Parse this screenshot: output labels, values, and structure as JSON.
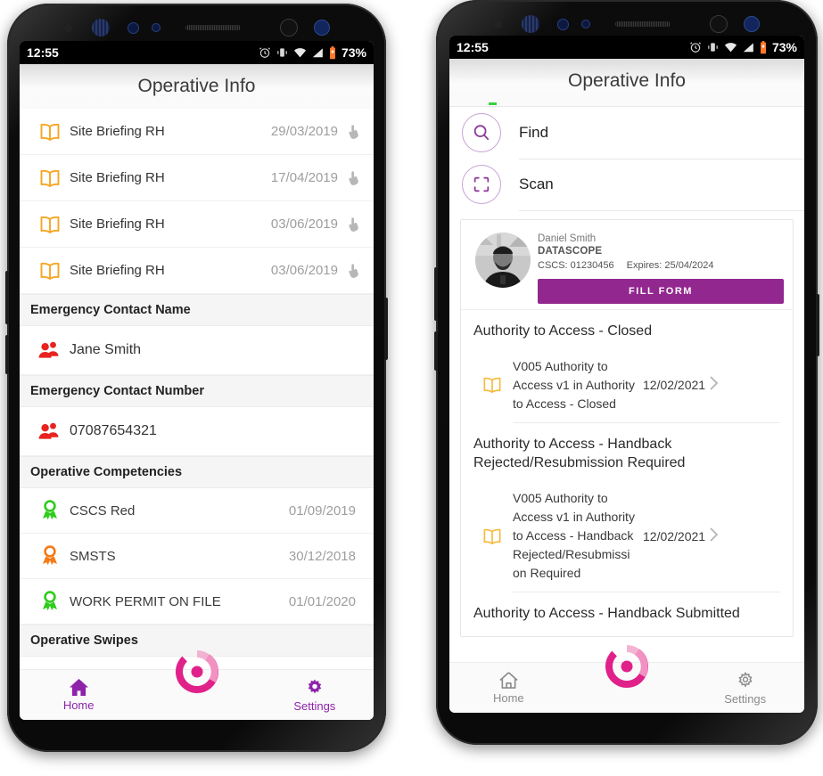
{
  "app": {
    "title": "Operative Info",
    "brand_purple": "#8e24aa",
    "brand_magenta": "#e0218a",
    "fill_button_color": "#92278f"
  },
  "status_bar": {
    "time": "12:55",
    "battery_percent": "73%",
    "icons": [
      "alarm-icon",
      "vibrate-icon",
      "wifi-icon",
      "signal-icon",
      "battery-icon"
    ]
  },
  "left_phone": {
    "header_title": "Operative Info",
    "briefings": [
      {
        "icon": "book-icon",
        "label": "Site Briefing RH",
        "date": "29/03/2019",
        "action_icon": "tap-hand-icon"
      },
      {
        "icon": "book-icon",
        "label": "Site Briefing RH",
        "date": "17/04/2019",
        "action_icon": "tap-hand-icon"
      },
      {
        "icon": "book-icon",
        "label": "Site Briefing RH",
        "date": "03/06/2019",
        "action_icon": "tap-hand-icon"
      },
      {
        "icon": "book-icon",
        "label": "Site Briefing RH",
        "date": "03/06/2019",
        "action_icon": "tap-hand-icon"
      }
    ],
    "sections": [
      {
        "heading": "Emergency Contact Name",
        "icon": "contacts-icon",
        "value": "Jane Smith"
      },
      {
        "heading": "Emergency Contact Number",
        "icon": "contacts-icon",
        "value": "07087654321"
      }
    ],
    "competencies_heading": "Operative Competencies",
    "competencies": [
      {
        "icon": "award-icon",
        "color": "#2ecc1b",
        "label": "CSCS Red",
        "date": "01/09/2019"
      },
      {
        "icon": "award-icon",
        "color": "#f47a16",
        "label": "SMSTS",
        "date": "30/12/2018"
      },
      {
        "icon": "award-icon",
        "color": "#2ecc1b",
        "label": "WORK PERMIT ON FILE",
        "date": "01/01/2020"
      }
    ],
    "swipes_heading": "Operative Swipes",
    "bottom_nav": {
      "home_label": "Home",
      "settings_label": "Settings",
      "home_icon": "home-icon",
      "settings_icon": "gear-icon",
      "center_icon": "app-logo-icon",
      "state": "selected"
    }
  },
  "right_phone": {
    "header_title": "Operative Info",
    "actions": [
      {
        "icon": "search-icon",
        "label": "Find"
      },
      {
        "icon": "scan-icon",
        "label": "Scan"
      }
    ],
    "profile": {
      "avatar": "operative-avatar",
      "name": "Daniel Smith",
      "company": "DATASCOPE",
      "cscs_label": "CSCS: 01230456",
      "expires_label": "Expires: 25/04/2024",
      "fill_form_button": "FILL FORM"
    },
    "form_groups": [
      {
        "title": "Authority to Access - Closed",
        "items": [
          {
            "icon": "book-icon",
            "text": "V005 Authority to Access v1 in Authority to Access - Closed",
            "date": "12/02/2021",
            "chevron": "chevron-right-icon"
          }
        ]
      },
      {
        "title": "Authority to Access - Handback Rejected/Resubmission Required",
        "items": [
          {
            "icon": "book-icon",
            "text": "V005 Authority to Access v1 in Authority to Access - Handback Rejected/Resubmissi on Required",
            "date": "12/02/2021",
            "chevron": "chevron-right-icon"
          }
        ]
      },
      {
        "title": "Authority to Access - Handback Submitted",
        "items": []
      }
    ],
    "bottom_nav": {
      "home_label": "Home",
      "settings_label": "Settings",
      "home_icon": "home-icon",
      "settings_icon": "gear-icon",
      "center_icon": "app-logo-icon",
      "state": "unselected"
    }
  }
}
